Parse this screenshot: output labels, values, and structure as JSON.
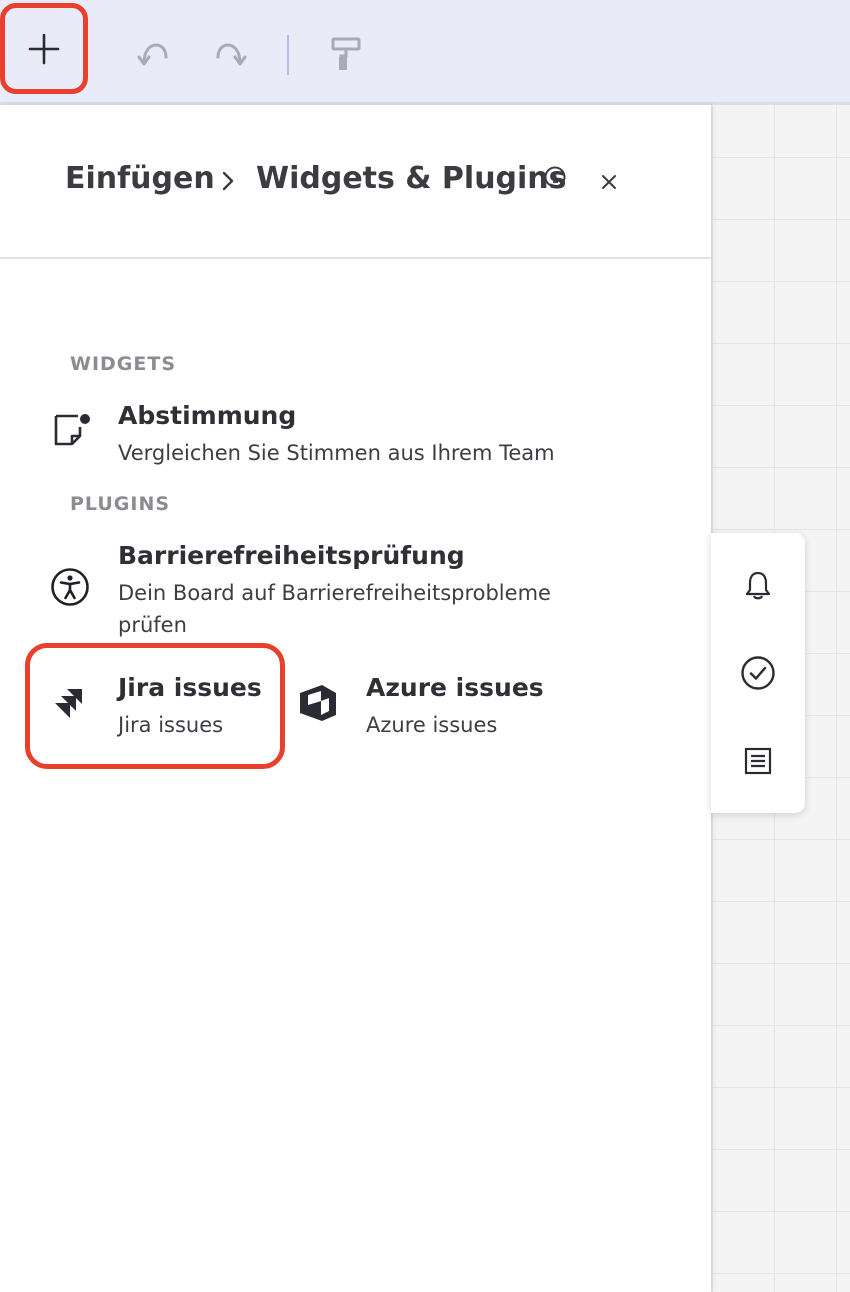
{
  "toolbar": {
    "buttons": [
      {
        "name": "add",
        "icon": "plus-icon"
      },
      {
        "name": "undo",
        "icon": "undo-icon"
      },
      {
        "name": "redo",
        "icon": "redo-icon"
      },
      {
        "name": "format",
        "icon": "paint-roller-icon"
      }
    ]
  },
  "panel": {
    "breadcrumb": {
      "root": "Einfügen",
      "current": "Widgets & Plugins"
    },
    "sections": {
      "widgets": {
        "title": "WIDGETS",
        "items": [
          {
            "title": "Abstimmung",
            "description": "Vergleichen Sie Stimmen aus Ihrem Team",
            "icon": "sticky-note-vote-icon"
          }
        ]
      },
      "plugins": {
        "title": "PLUGINS",
        "items": [
          {
            "title": "Barrierefreiheitsprüfung",
            "description": "Dein Board auf Barrierefreiheitsprobleme prüfen",
            "icon": "accessibility-icon"
          },
          {
            "title": "Jira issues",
            "description": "Jira issues",
            "icon": "jira-icon"
          },
          {
            "title": "Azure issues",
            "description": "Azure issues",
            "icon": "azure-devops-icon"
          }
        ]
      }
    }
  },
  "side_rail": {
    "buttons": [
      {
        "name": "notifications",
        "icon": "bell-icon"
      },
      {
        "name": "tasks",
        "icon": "check-circle-icon"
      },
      {
        "name": "notes",
        "icon": "list-icon"
      }
    ]
  },
  "colors": {
    "highlight": "#e8402c",
    "toolbar_bg": "#eaebf8",
    "text_primary": "#2f2f36",
    "text_secondary": "#8b8b92"
  }
}
